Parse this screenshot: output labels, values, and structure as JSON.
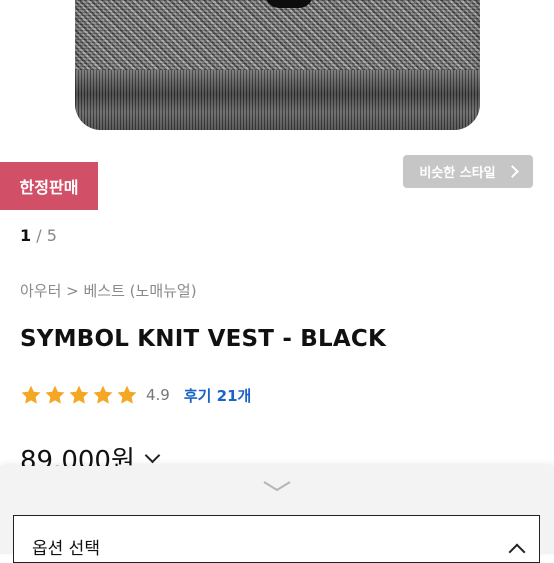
{
  "badge": {
    "limited": "한정판매"
  },
  "similar_style": {
    "label": "비슷한 스타일"
  },
  "pager": {
    "current": "1",
    "separator": " / ",
    "total": "5"
  },
  "breadcrumb": "아우터 > 베스트 (노매뉴얼)",
  "product": {
    "title": "SYMBOL KNIT VEST - BLACK",
    "rating": "4.9",
    "stars": 5,
    "reviews_label": "후기 21개",
    "price": "89.000원"
  },
  "option": {
    "placeholder": "옵션 선택"
  },
  "colors": {
    "badge": "#d24f68",
    "star": "#f5a623",
    "link": "#1a63c7"
  },
  "icons": {
    "star": "star-icon",
    "price_toggle": "chevron-down-icon",
    "sheet_handle": "chevron-down-icon",
    "option_toggle": "chevron-up-icon",
    "similar_arrow": "chevron-right-icon"
  }
}
